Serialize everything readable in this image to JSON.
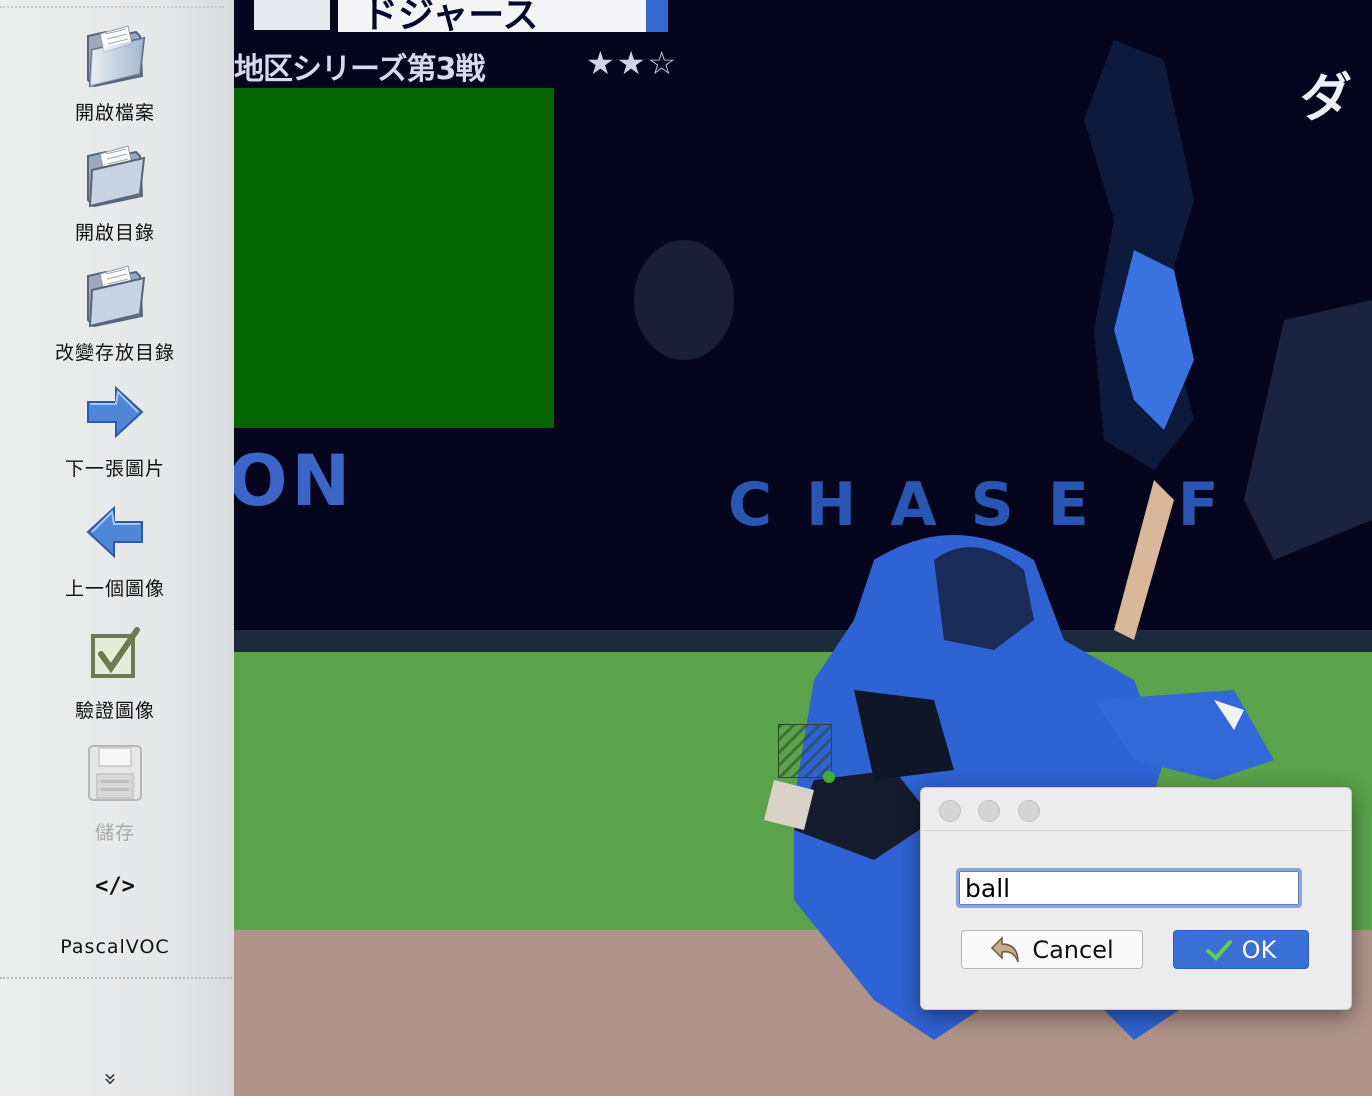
{
  "toolbar": {
    "items": [
      {
        "label": "開啟檔案",
        "icon": "open-folder-icon"
      },
      {
        "label": "開啟目錄",
        "icon": "open-folder-icon"
      },
      {
        "label": "改變存放目錄",
        "icon": "open-folder-icon"
      },
      {
        "label": "下一張圖片",
        "icon": "arrow-right-icon"
      },
      {
        "label": "上一個圖像",
        "icon": "arrow-left-icon"
      },
      {
        "label": "驗證圖像",
        "icon": "checkbox-icon"
      },
      {
        "label": "儲存",
        "icon": "floppy-disk-icon",
        "disabled": true
      },
      {
        "label": "PascalVOC",
        "icon": "code-icon",
        "glyph": "</>"
      }
    ],
    "more_glyph": "»"
  },
  "image_overlay": {
    "caption": "地区シリーズ第3戦",
    "stars": "★★☆",
    "banner_text": "ドジャース",
    "wall_left": "ON",
    "wall_sign": "CHASE F",
    "right_text": "ダ"
  },
  "dialog": {
    "input_value": "ball",
    "cancel_label": "Cancel",
    "ok_label": "OK"
  },
  "colors": {
    "ok_button": "#3a70d6",
    "field_green": "#5aa34a",
    "scoreboard_green": "#026500",
    "bbox_handle": "#3fae3a"
  }
}
